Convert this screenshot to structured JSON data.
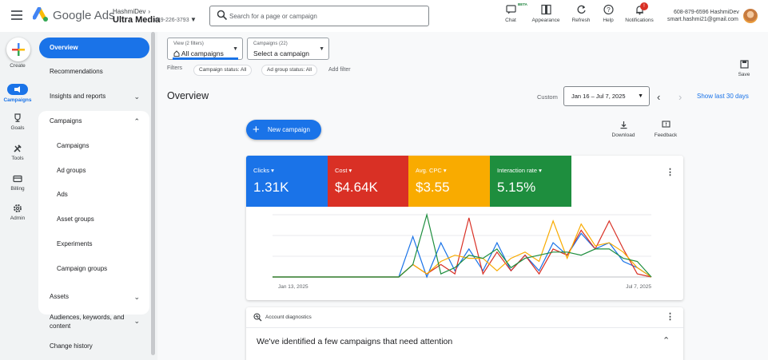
{
  "header": {
    "brand": "Google Ads",
    "account_owner": "HashmiDev",
    "account_name": "Ultra Media",
    "account_id": "449-226-3793",
    "search_placeholder": "Search for a page or campaign",
    "buttons": [
      {
        "label": "Chat",
        "icon": "chat-icon"
      },
      {
        "label": "Appearance",
        "icon": "appearance-icon"
      },
      {
        "label": "Refresh",
        "icon": "refresh-icon"
      },
      {
        "label": "Help",
        "icon": "help-icon"
      },
      {
        "label": "Notifications",
        "icon": "bell-icon"
      }
    ],
    "beta_label": "BETA",
    "notification_count": "!",
    "user_phone": "608-879-6596 HashmiDev",
    "user_email": "smart.hashmi21@gmail.com"
  },
  "rail": {
    "create": "Create",
    "items": [
      {
        "label": "Campaigns",
        "icon": "campaigns-icon"
      },
      {
        "label": "Goals",
        "icon": "trophy-icon"
      },
      {
        "label": "Tools",
        "icon": "tools-icon"
      },
      {
        "label": "Billing",
        "icon": "billing-icon"
      },
      {
        "label": "Admin",
        "icon": "gear-icon"
      }
    ]
  },
  "nav": {
    "overview": "Overview",
    "recommendations": "Recommendations",
    "insights": "Insights and reports",
    "campaigns_group": "Campaigns",
    "sub_items": [
      "Campaigns",
      "Ad groups",
      "Ads",
      "Asset groups",
      "Experiments",
      "Campaign groups"
    ],
    "assets": "Assets",
    "audiences": "Audiences, keywords, and content",
    "change_history": "Change history"
  },
  "main": {
    "view_small": "View (2 filters)",
    "view_big": "All campaigns",
    "campaigns_small": "Campaigns (22)",
    "campaigns_big": "Select a campaign",
    "filters_label": "Filters",
    "chips": [
      "Campaign status: All",
      "Ad group status: All"
    ],
    "add_filter": "Add filter",
    "save": "Save",
    "title": "Overview",
    "custom": "Custom",
    "date_range": "Jan 16 – Jul 7, 2025",
    "show_last": "Show last 30 days",
    "new_campaign": "New campaign",
    "download": "Download",
    "feedback": "Feedback",
    "metrics": [
      {
        "label": "Clicks",
        "value": "1.31K",
        "color": "#1a73e8"
      },
      {
        "label": "Cost",
        "value": "$4.64K",
        "color": "#d93025"
      },
      {
        "label": "Avg. CPC",
        "value": "$3.55",
        "color": "#f9ab00"
      },
      {
        "label": "Interaction rate",
        "value": "5.15%",
        "color": "#1e8e3e"
      }
    ],
    "diag_header": "Account diagnostics",
    "diag_message": "We've identified a few campaigns that need attention"
  },
  "chart_data": {
    "type": "line",
    "x_labels": [
      "Jan 13, 2025",
      "Jul 7, 2025"
    ],
    "grid": true,
    "series": [
      {
        "color": "#1a73e8",
        "values": [
          0,
          0,
          0,
          0,
          0,
          0,
          0,
          0,
          0,
          0,
          0.65,
          0,
          0.55,
          0.1,
          0.45,
          0.1,
          0.55,
          0.1,
          0.35,
          0.1,
          0.55,
          0.35,
          0.7,
          0.45,
          0.55,
          0.25,
          0.15,
          0
        ]
      },
      {
        "color": "#d93025",
        "values": [
          0,
          0,
          0,
          0,
          0,
          0,
          0,
          0,
          0,
          0,
          0.2,
          0.05,
          0.2,
          0.05,
          0.95,
          0.05,
          0.4,
          0.1,
          0.35,
          0.05,
          0.45,
          0.35,
          0.75,
          0.45,
          0.9,
          0.45,
          0.05,
          0
        ]
      },
      {
        "color": "#f9ab00",
        "values": [
          0,
          0,
          0,
          0,
          0,
          0,
          0,
          0,
          0,
          0,
          0.2,
          0.05,
          0.25,
          0.35,
          0.3,
          0.3,
          0.1,
          0.3,
          0.4,
          0.25,
          0.9,
          0.3,
          0.85,
          0.5,
          0.55,
          0.4,
          0.15,
          0
        ]
      },
      {
        "color": "#1e8e3e",
        "values": [
          0,
          0,
          0,
          0,
          0,
          0,
          0,
          0,
          0,
          0,
          0.2,
          1.0,
          0.05,
          0.15,
          0.35,
          0.3,
          0.45,
          0.15,
          0.3,
          0.35,
          0.4,
          0.4,
          0.35,
          0.45,
          0.45,
          0.3,
          0.25,
          0
        ]
      }
    ]
  }
}
